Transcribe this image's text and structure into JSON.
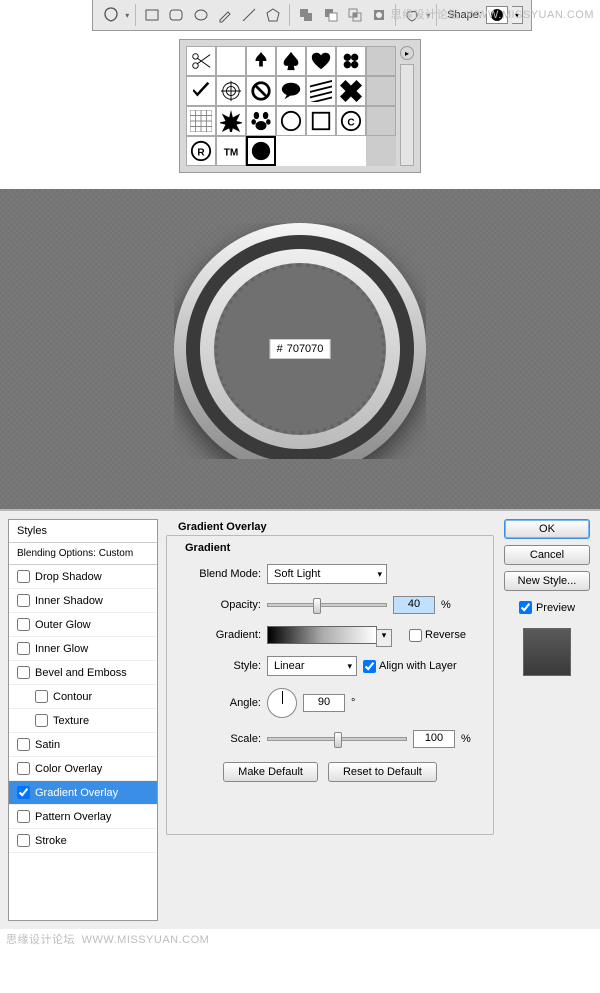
{
  "watermark": {
    "text": "思缘设计论坛",
    "url": "WWW.MISSYUAN.COM"
  },
  "toolbar": {
    "shape_label": "Shape:",
    "icons": [
      "blob",
      "rect",
      "round-rect",
      "ellipse",
      "polygon",
      "line",
      "star",
      "pen",
      "freeform",
      "add",
      "subtract",
      "intersect",
      "exclude",
      "custom"
    ]
  },
  "palette": {
    "shapes": [
      "scissors",
      "blank",
      "fleur",
      "spade",
      "heart",
      "clover",
      "check",
      "target",
      "no",
      "speech",
      "stripes",
      "pix",
      "grid",
      "burst",
      "paw",
      "ring",
      "square",
      "copyright",
      "registered",
      "trademark",
      "circle"
    ]
  },
  "hex": {
    "prefix": "#",
    "value": "707070"
  },
  "dialog": {
    "styles_header": "Styles",
    "blending_sub": "Blending Options: Custom",
    "items": [
      {
        "label": "Drop Shadow",
        "checked": false
      },
      {
        "label": "Inner Shadow",
        "checked": false
      },
      {
        "label": "Outer Glow",
        "checked": false
      },
      {
        "label": "Inner Glow",
        "checked": false
      },
      {
        "label": "Bevel and Emboss",
        "checked": false
      },
      {
        "label": "Contour",
        "checked": false,
        "indent": true
      },
      {
        "label": "Texture",
        "checked": false,
        "indent": true
      },
      {
        "label": "Satin",
        "checked": false
      },
      {
        "label": "Color Overlay",
        "checked": false
      },
      {
        "label": "Gradient Overlay",
        "checked": true,
        "active": true
      },
      {
        "label": "Pattern Overlay",
        "checked": false
      },
      {
        "label": "Stroke",
        "checked": false
      }
    ],
    "group_title": "Gradient Overlay",
    "group_sub": "Gradient",
    "blend_mode_lbl": "Blend Mode:",
    "blend_mode_val": "Soft Light",
    "opacity_lbl": "Opacity:",
    "opacity_val": "40",
    "opacity_unit": "%",
    "gradient_lbl": "Gradient:",
    "reverse_lbl": "Reverse",
    "style_lbl": "Style:",
    "style_val": "Linear",
    "align_lbl": "Align with Layer",
    "angle_lbl": "Angle:",
    "angle_val": "90",
    "angle_unit": "°",
    "scale_lbl": "Scale:",
    "scale_val": "100",
    "scale_unit": "%",
    "make_default": "Make Default",
    "reset_default": "Reset to Default",
    "ok": "OK",
    "cancel": "Cancel",
    "new_style": "New Style...",
    "preview_lbl": "Preview"
  }
}
